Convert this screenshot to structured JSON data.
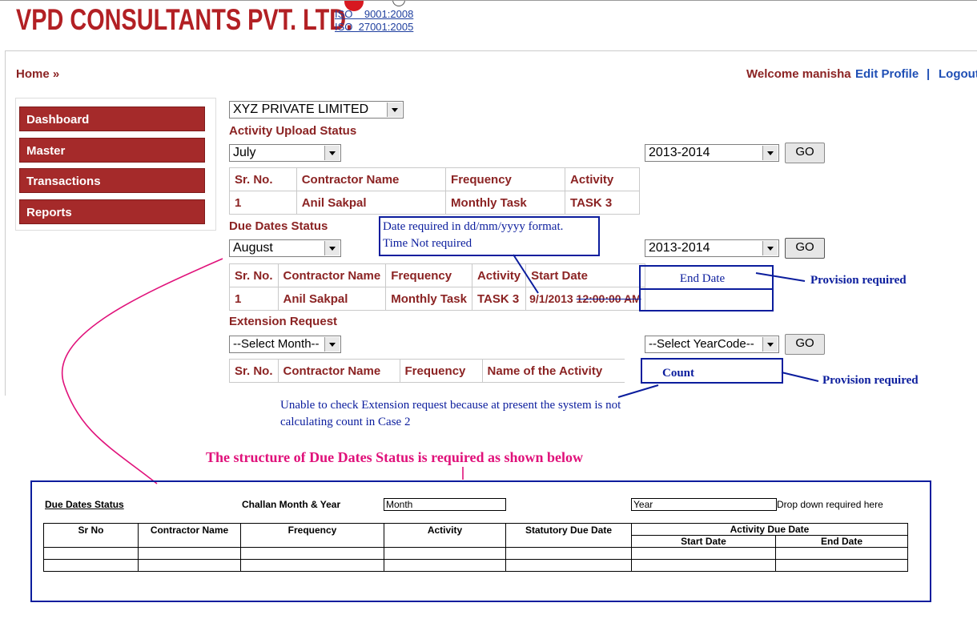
{
  "header": {
    "logo_text": "VPD CONSULTANTS PVT. LTD.",
    "iso1": "ISO    9001:2008",
    "iso2": "ISO  27001:2005"
  },
  "nav": {
    "home": "Home »",
    "welcome": "Welcome manisha",
    "edit_profile": "Edit Profile",
    "separator": "|",
    "logout": "Logout"
  },
  "sidebar": {
    "items": [
      {
        "label": "Dashboard"
      },
      {
        "label": "Master"
      },
      {
        "label": "Transactions"
      },
      {
        "label": "Reports"
      }
    ]
  },
  "company_select": "XYZ PRIVATE LIMITED",
  "activity_upload": {
    "title": "Activity Upload Status",
    "month": "July",
    "year": "2013-2014",
    "go": "GO",
    "headers": [
      "Sr. No.",
      "Contractor Name",
      "Frequency",
      "Activity"
    ],
    "rows": [
      [
        "1",
        "Anil Sakpal",
        "Monthly Task",
        "TASK 3"
      ]
    ]
  },
  "due_dates": {
    "title": "Due Dates Status",
    "month": "August",
    "year": "2013-2014",
    "go": "GO",
    "headers": [
      "Sr. No.",
      "Contractor Name",
      "Frequency",
      "Activity",
      "Start Date"
    ],
    "rows": [
      [
        "1",
        "Anil Sakpal",
        "Monthly Task",
        "TASK 3",
        "9/1/2013",
        "12:00:00 AM"
      ]
    ]
  },
  "extension": {
    "title": "Extension Request",
    "month": "--Select Month--",
    "year": "--Select YearCode--",
    "go": "GO",
    "headers": [
      "Sr. No.",
      "Contractor Name",
      "Frequency",
      "Name of the Activity"
    ]
  },
  "annotations": {
    "date_note_1": "Date required in dd/mm/yyyy format.",
    "date_note_2": "Time Not required",
    "end_date": "End Date",
    "provision1": "Provision required",
    "count": "Count",
    "provision2": "Provision required",
    "ext_note_1": "Unable to check Extension request because at present the system is not",
    "ext_note_2": "calculating count in Case 2",
    "structure_title": "The structure of Due Dates Status is required as shown below"
  },
  "structure": {
    "title": "Due Dates Status",
    "challan_label": "Challan Month & Year",
    "month_placeholder": "Month",
    "year_placeholder": "Year",
    "dropdown_note": "Drop down required here",
    "headers": [
      "Sr No",
      "Contractor Name",
      "Frequency",
      "Activity",
      "Statutory Due Date",
      "Activity Due Date"
    ],
    "sub_headers": [
      "Start Date",
      "End Date"
    ]
  },
  "colors": {
    "brand": "#a52a2a",
    "text_red": "#8b2323",
    "link_blue": "#1f4fb5",
    "annot_blue": "#0b1d9d",
    "annot_magenta": "#e0117a"
  }
}
